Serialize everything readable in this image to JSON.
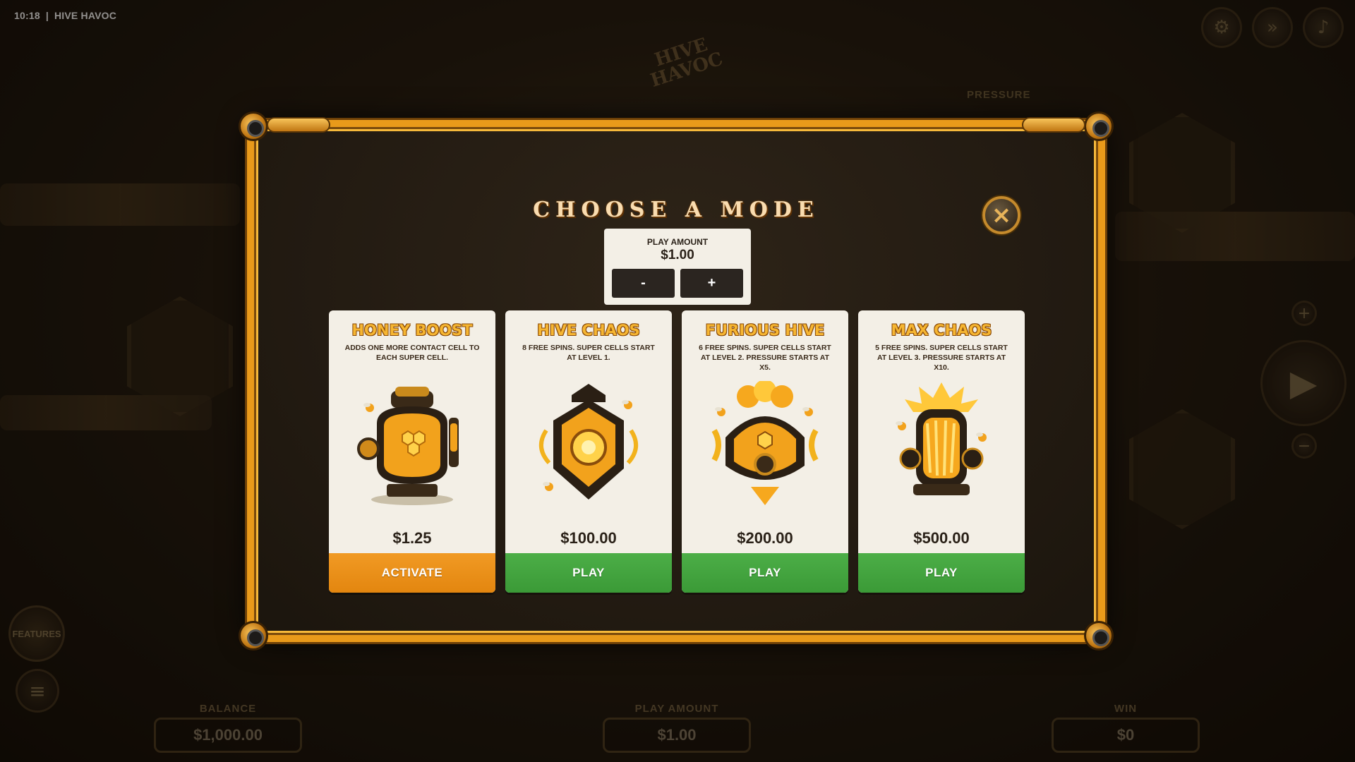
{
  "status": {
    "time": "10:18",
    "separator": "|",
    "game_name": "HIVE HAVOC"
  },
  "background": {
    "logo_text": "HIVE HAVOC",
    "pressure_label": "PRESSURE",
    "features_label": "FEATURES",
    "balance": {
      "label": "BALANCE",
      "value": "$1,000.00"
    },
    "play_amount": {
      "label": "PLAY AMOUNT",
      "value": "$1.00"
    },
    "win": {
      "label": "WIN",
      "value": "$0"
    },
    "icons": [
      "settings-gear-icon",
      "turbo-icon",
      "sound-icon",
      "plus-icon",
      "spin-play-icon",
      "minus-icon",
      "menu-icon"
    ]
  },
  "modal": {
    "title": "CHOOSE A MODE",
    "close_icon": "×",
    "play_amount": {
      "label": "PLAY AMOUNT",
      "value": "$1.00",
      "minus_label": "-",
      "plus_label": "+"
    },
    "cards": [
      {
        "title": "HONEY BOOST",
        "description": "ADDS ONE MORE CONTACT CELL TO EACH SUPER CELL.",
        "price": "$1.25",
        "button_label": "ACTIVATE",
        "art": "honey-boiler-icon"
      },
      {
        "title": "HIVE CHAOS",
        "description": "8 FREE SPINS. SUPER CELLS START AT LEVEL 1.",
        "price": "$100.00",
        "button_label": "PLAY",
        "art": "hive-core-icon"
      },
      {
        "title": "FURIOUS HIVE",
        "description": "6 FREE SPINS. SUPER CELLS START AT LEVEL 2. PRESSURE STARTS AT X5.",
        "price": "$200.00",
        "button_label": "PLAY",
        "art": "furious-hive-icon"
      },
      {
        "title": "MAX CHAOS",
        "description": "5 FREE SPINS. SUPER CELLS START AT LEVEL 3. PRESSURE STARTS AT X10.",
        "price": "$500.00",
        "button_label": "PLAY",
        "art": "exploding-hive-icon"
      }
    ]
  },
  "colors": {
    "frame_gold": "#e99a1a",
    "activate_orange": "#f19a24",
    "play_green": "#4cae47",
    "card_bg": "#f3efe6",
    "title_gold": "#f6b632"
  }
}
